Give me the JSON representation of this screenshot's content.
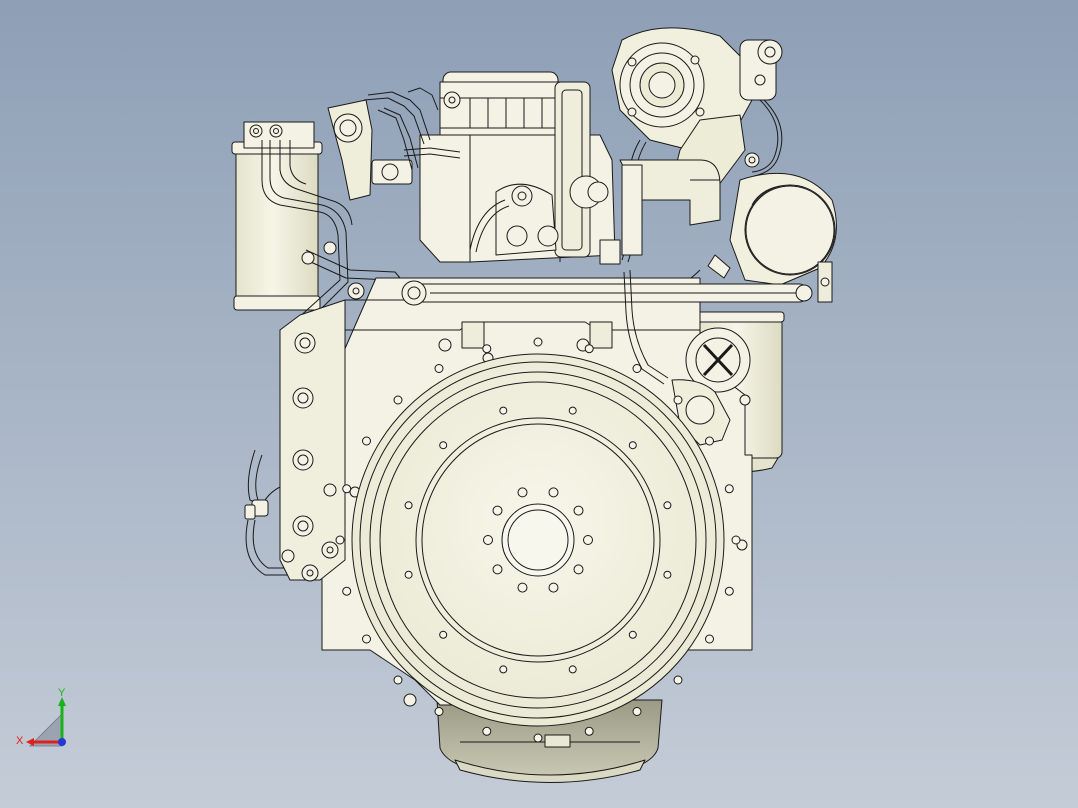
{
  "viewport": {
    "background_top": "#8e9fb6",
    "background_bottom": "#c4ccd7"
  },
  "model": {
    "fill_color": "#f3f2e4",
    "shade_color": "#e6e5cf",
    "oil_pan_color": "#b8b8a2",
    "line_color": "#1a1a1a"
  },
  "triad": {
    "x_label": "X",
    "y_label": "Y",
    "x_color": "#e0201c",
    "y_color": "#19b21b",
    "z_color": "#2436d6"
  }
}
